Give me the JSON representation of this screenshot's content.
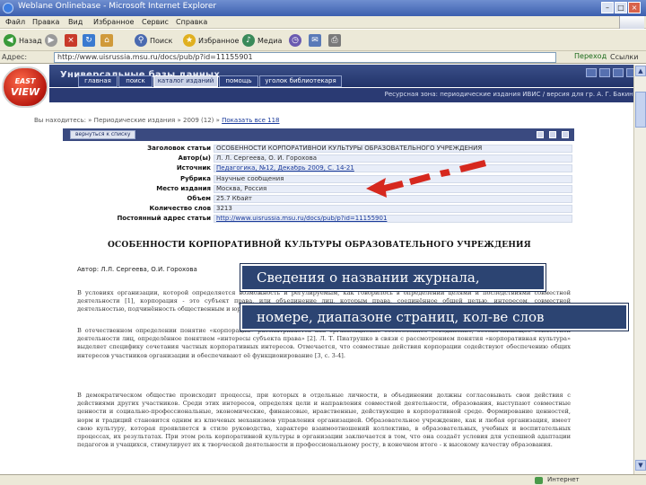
{
  "window": {
    "title": "Weblane Onlinebase - Microsoft Internet Explorer"
  },
  "menu": [
    "Файл",
    "Правка",
    "Вид",
    "Избранное",
    "Сервис",
    "Справка"
  ],
  "toolbar": {
    "back": "Назад",
    "search": "Поиск",
    "favorites": "Избранное",
    "media": "Медиа"
  },
  "address": {
    "label": "Адрес:",
    "url": "http://www.uisrussia.msu.ru/docs/pub/p?id=11155901",
    "go": "Переход",
    "links": "Ссылки"
  },
  "logo": {
    "line1": "EAST",
    "line2": "VIEW"
  },
  "site": {
    "title": "Универсальные базы данных",
    "nav": [
      {
        "label": "главная",
        "active": false
      },
      {
        "label": "поиск",
        "active": false
      },
      {
        "label": "каталог изданий",
        "active": true
      },
      {
        "label": "помощь",
        "active": false
      },
      {
        "label": "уголок библиотекаря",
        "active": false
      }
    ],
    "subheader": "Ресурсная зона: периодические издания ИВИС / версия для гр. А. Г. Бакина"
  },
  "breadcrumb": {
    "prefix": "Вы находитесь: » Периодические издания » 2009 (12) » ",
    "link": "Показать все 118"
  },
  "meta": {
    "button": "вернуться к списку",
    "rows": [
      {
        "key": "Заголовок статьи",
        "value": "ОСОБЕННОСТИ КОРПОРАТИВНОЙ КУЛЬТУРЫ ОБРАЗОВАТЕЛЬНОГО УЧРЕЖДЕНИЯ",
        "link": false
      },
      {
        "key": "Автор(ы)",
        "value": "Л. Л. Сергеева, О. И. Горохова",
        "link": false
      },
      {
        "key": "Источник",
        "value": "Педагогика, №12, Декабрь 2009, С. 14-21",
        "link": true
      },
      {
        "key": "Рубрика",
        "value": "Научные сообщения",
        "link": false
      },
      {
        "key": "Место издания",
        "value": "Москва, Россия",
        "link": false
      },
      {
        "key": "Объем",
        "value": "25.7 Кбайт",
        "link": false
      },
      {
        "key": "Количество слов",
        "value": "3213",
        "link": false
      },
      {
        "key": "Постоянный адрес статьи",
        "value": "http://www.uisrussia.msu.ru/docs/pub/p?id=11155901",
        "link": true
      }
    ]
  },
  "doc": {
    "title": "ОСОБЕННОСТИ КОРПОРАТИВНОЙ КУЛЬТУРЫ ОБРАЗОВАТЕЛЬНОГО УЧРЕЖДЕНИЯ",
    "authors": "Автор: Л.Л. Сергеева, О.И. Горохова",
    "paragraphs": [
      "В условиях организации, которой определяется возможность и регулируемым, как говорилось в определении целями и последствиями совместной деятельности [1], корпорация - это субъект права, или объединение лиц, которым права, соединённое общей целью, интересом, совместной деятельностью, подчинённость общественным и юридическим нормам, сохранением совместного действия.",
      "В отечественном определении понятие «корпорация» рассматривается как организационно обособленное объединение, обеспечивающее совместной деятельности лиц, определённое понятием «интересы субъекта права» [2]. Л. Т. Пиатрушко в связи с рассмотрением понятия «корпоративная культура» выделяет специфику сочетания частных корпоративных интересов. Отмечается, что совместные действия корпорации содействуют обеспечению общих интересов участников организации и обеспечивают её функционирование [3, с. 3-4].",
      "В демократическом обществе происходит процессы, при которых в отдельные личности, в объединении должны согласовывать свои действия с действиями других участников. Среди этих интересов, определяя цели и направления совместной деятельности, образования, выступают совместные ценности и социально-профессиональные, экономические, финансовые, нравственные, действующие в корпоративной среде. Формирование ценностей, норм и традиций становится одним из ключевых механизмов управления организацией. Образовательное учреждение, как и любая организация, имеет свою культуру, которая проявляется в стиле руководства, характере взаимоотношений коллектива, в образовательных, учебных и воспитательных процессах, их результатах. При этом роль корпоративной культуры в организации заключается в том, что она создаёт условия для успешной адаптации педагогов и учащихся, стимулирует их к творческой деятельности и профессиональному росту, в конечном итоге - к высокому качеству образования."
    ]
  },
  "callouts": [
    "Сведения о названии журнала,",
    "номере, диапазоне страниц, кол-ве слов"
  ],
  "status": {
    "zone": "Интернет"
  },
  "colors": {
    "header_navy": "#22336a",
    "callout_bg": "#2c4472",
    "arrow_red": "#d6281e",
    "logo_red": "#b91a10"
  }
}
